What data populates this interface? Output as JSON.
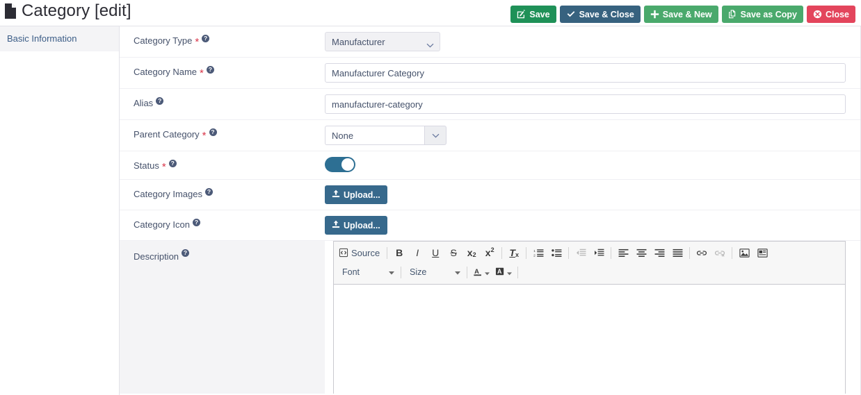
{
  "header": {
    "title": "Category [edit]",
    "doc_icon": "file-icon",
    "buttons": [
      {
        "id": "save",
        "label": "Save",
        "icon": "pencil-square-icon",
        "color": "#1f9158"
      },
      {
        "id": "save-close",
        "label": "Save & Close",
        "icon": "check-icon",
        "color": "#37627f"
      },
      {
        "id": "save-new",
        "label": "Save & New",
        "icon": "plus-icon",
        "color": "#4aa96c"
      },
      {
        "id": "save-as-copy",
        "label": "Save as Copy",
        "icon": "copy-icon",
        "color": "#4aa96c"
      },
      {
        "id": "close",
        "label": "Close",
        "icon": "times-circle-icon",
        "color": "#e3455c"
      }
    ]
  },
  "sidebar": {
    "items": [
      {
        "id": "basic-information",
        "label": "Basic Information",
        "active": true
      }
    ]
  },
  "form": {
    "fields": [
      {
        "id": "category-type",
        "label": "Category Type",
        "required": true,
        "help": "?",
        "control": "select",
        "value": "Manufacturer",
        "options": [
          "Manufacturer"
        ]
      },
      {
        "id": "category-name",
        "label": "Category Name",
        "required": true,
        "help": "?",
        "control": "text",
        "value": "Manufacturer Category",
        "placeholder": ""
      },
      {
        "id": "alias",
        "label": "Alias",
        "required": false,
        "help": "?",
        "control": "text",
        "value": "manufacturer-category",
        "placeholder": ""
      },
      {
        "id": "parent-category",
        "label": "Parent Category",
        "required": true,
        "help": "?",
        "control": "picker",
        "value": "None",
        "options": [
          "None"
        ]
      },
      {
        "id": "status",
        "label": "Status",
        "required": true,
        "help": "?",
        "control": "toggle",
        "value": "on"
      },
      {
        "id": "category-images",
        "label": "Category Images",
        "required": false,
        "help": "?",
        "control": "upload",
        "value": "Upload..."
      },
      {
        "id": "category-icon",
        "label": "Category Icon",
        "required": false,
        "help": "?",
        "control": "upload",
        "value": "Upload..."
      },
      {
        "id": "description",
        "label": "Description",
        "required": false,
        "help": "?",
        "control": "richtext",
        "value": ""
      }
    ]
  },
  "editor": {
    "source_label": "Source",
    "font_label": "Font",
    "size_label": "Size",
    "content": "",
    "toolbar_row1": [
      "source-icon",
      "bold-icon",
      "italic-icon",
      "underline-icon",
      "strikethrough-icon",
      "subscript-icon",
      "superscript-icon",
      "remove-format-icon",
      "numbered-list-icon",
      "bulleted-list-icon",
      "outdent-icon",
      "indent-icon",
      "align-left-icon",
      "align-center-icon",
      "align-right-icon",
      "align-justify-icon",
      "link-icon",
      "unlink-icon",
      "image-icon",
      "template-icon"
    ],
    "toolbar_row2": [
      "font-dropdown",
      "size-dropdown",
      "text-color-icon",
      "background-color-icon"
    ]
  },
  "colors": {
    "accent": "#37698c",
    "toggle_on": "#2d6f93",
    "required": "#d9364a",
    "label_text": "#46526b",
    "link_text": "#3b5c86"
  }
}
